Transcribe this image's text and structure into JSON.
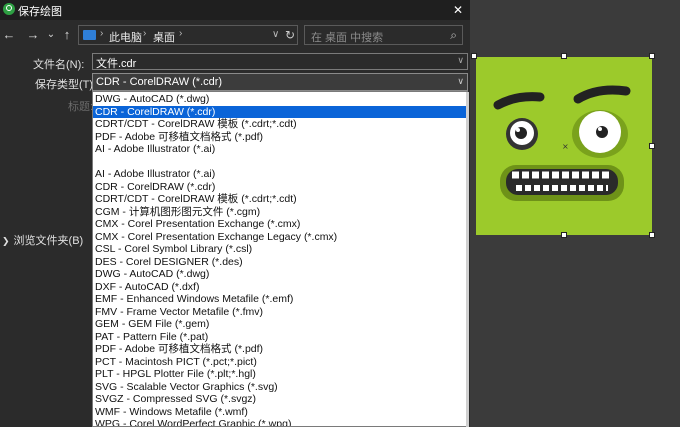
{
  "window": {
    "title": "保存绘图",
    "close": "✕"
  },
  "nav": {
    "back": "←",
    "forward": "→",
    "dropdown": "⌄",
    "up": "↑",
    "breadcrumbs": [
      "此电脑",
      "桌面"
    ],
    "separator": "›",
    "refresh": "↻",
    "search_placeholder": "在 桌面 中搜索",
    "search_icon": "⌕"
  },
  "form": {
    "filename_label": "文件名(N):",
    "filename_value": "文件.cdr",
    "filetype_label": "保存类型(T):",
    "filetype_value": "CDR - CorelDRAW (*.cdr)",
    "dim_label": "标题:",
    "browse_label": "浏览文件夹(B)",
    "browse_chevron": "❯",
    "arrow": "∨"
  },
  "dropdown_options": [
    "DWG - AutoCAD (*.dwg)",
    "CDR - CorelDRAW (*.cdr)",
    "CDRT/CDT - CorelDRAW 模板 (*.cdrt;*.cdt)",
    "PDF - Adobe 可移植文档格式 (*.pdf)",
    "AI - Adobe Illustrator (*.ai)",
    "",
    "AI - Adobe Illustrator (*.ai)",
    "CDR - CorelDRAW (*.cdr)",
    "CDRT/CDT - CorelDRAW 模板 (*.cdrt;*.cdt)",
    "CGM - 计算机图形图元文件 (*.cgm)",
    "CMX - Corel Presentation Exchange (*.cmx)",
    "CMX - Corel Presentation Exchange Legacy (*.cmx)",
    "CSL - Corel Symbol Library (*.csl)",
    "DES - Corel DESIGNER (*.des)",
    "DWG - AutoCAD (*.dwg)",
    "DXF - AutoCAD (*.dxf)",
    "EMF - Enhanced Windows Metafile (*.emf)",
    "FMV - Frame Vector Metafile (*.fmv)",
    "GEM - GEM File (*.gem)",
    "PAT - Pattern File (*.pat)",
    "PDF - Adobe 可移植文档格式 (*.pdf)",
    "PCT - Macintosh PICT (*.pct;*.pict)",
    "PLT - HPGL Plotter File (*.plt;*.hgl)",
    "SVG - Scalable Vector Graphics  (*.svg)",
    "SVGZ - Compressed SVG  (*.svgz)",
    "WMF - Windows Metafile (*.wmf)",
    "WPG - Corel WordPerfect Graphic (*.wpg)"
  ],
  "selected_index": 1,
  "colors": {
    "selection": "#0a64d8",
    "artboard": "#9cca2b",
    "dialog_bg": "#2b2b2b"
  }
}
